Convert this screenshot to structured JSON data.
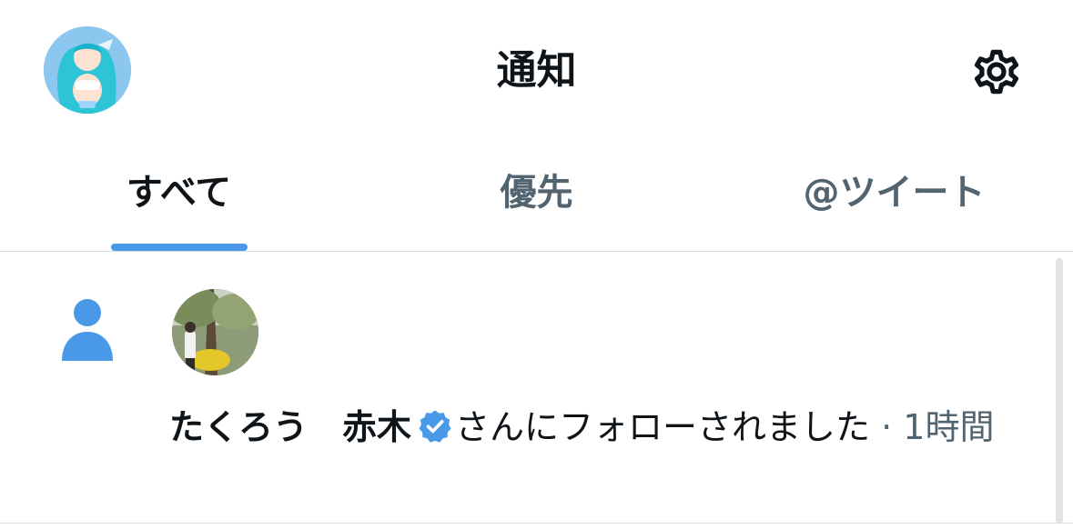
{
  "header": {
    "title": "通知",
    "profile_avatar_icon": "profile-avatar",
    "settings_icon": "gear-icon"
  },
  "tabs": [
    {
      "label": "すべて",
      "active": true
    },
    {
      "label": "優先",
      "active": false
    },
    {
      "label": "@ツイート",
      "active": false
    }
  ],
  "notification": {
    "type_icon": "person-icon",
    "user_name": "たくろう　赤木",
    "verified": true,
    "message": "さんにフォローされました",
    "separator": " · ",
    "time": "1時間"
  },
  "colors": {
    "accent": "#4a99e9",
    "text_primary": "#0f1419",
    "text_secondary": "#536471",
    "divider": "#dcdfe2"
  }
}
